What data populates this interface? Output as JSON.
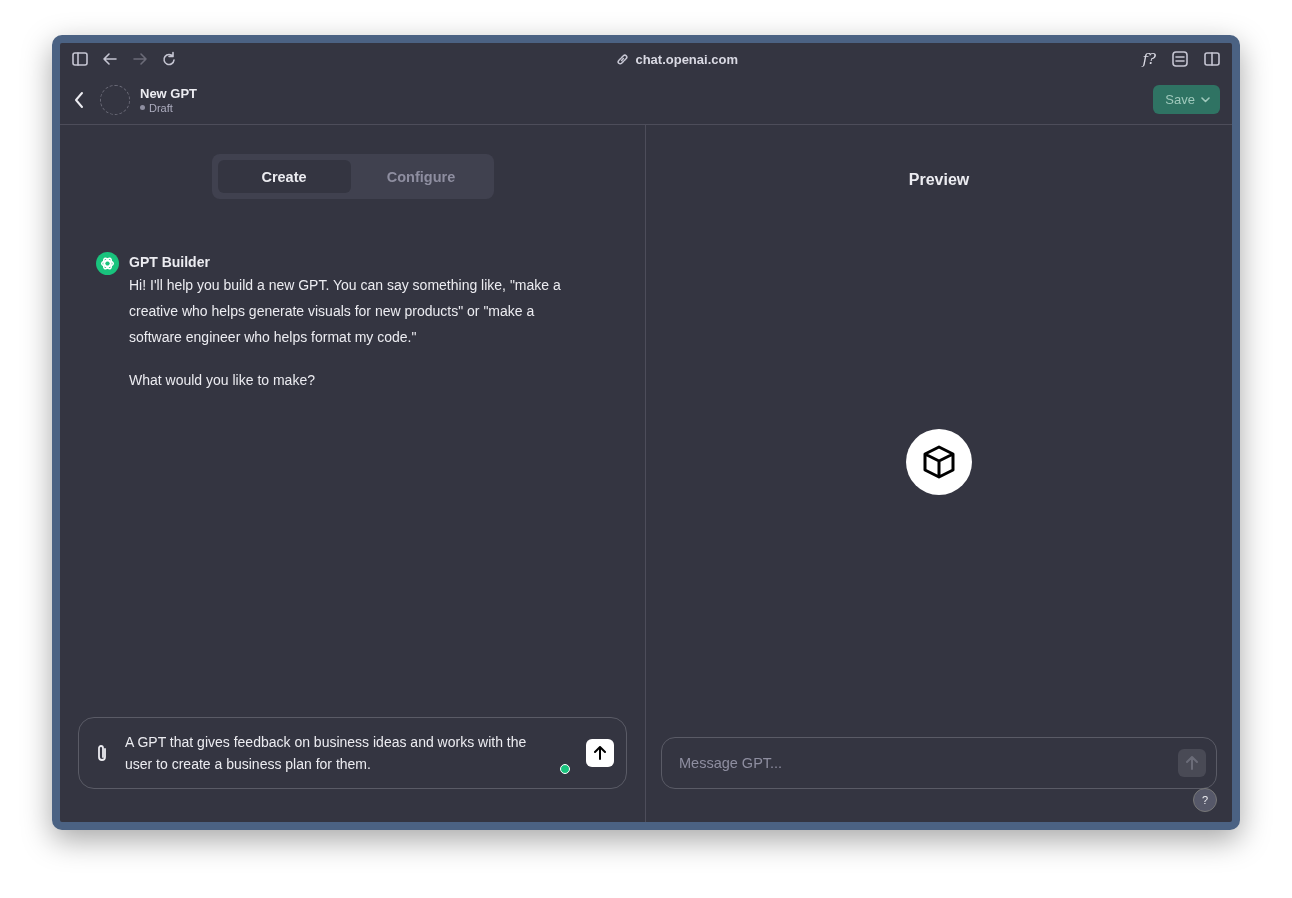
{
  "browser": {
    "url": "chat.openai.com",
    "extension_label": "f?",
    "forward_disabled": true
  },
  "header": {
    "title": "New GPT",
    "status": "Draft",
    "save_label": "Save"
  },
  "tabs": [
    {
      "label": "Create",
      "selected": true
    },
    {
      "label": "Configure",
      "selected": false
    }
  ],
  "messages": [
    {
      "sender": "GPT Builder",
      "paragraphs": [
        "Hi! I'll help you build a new GPT. You can say something like, \"make a creative who helps generate visuals for new products\" or \"make a software engineer who helps format my code.\"",
        "What would you like to make?"
      ]
    }
  ],
  "builder_input": {
    "value": "A GPT that gives feedback on business ideas and works with the user to create a business plan for them."
  },
  "preview": {
    "title": "Preview",
    "placeholder": "Message GPT...",
    "help_label": "?"
  }
}
